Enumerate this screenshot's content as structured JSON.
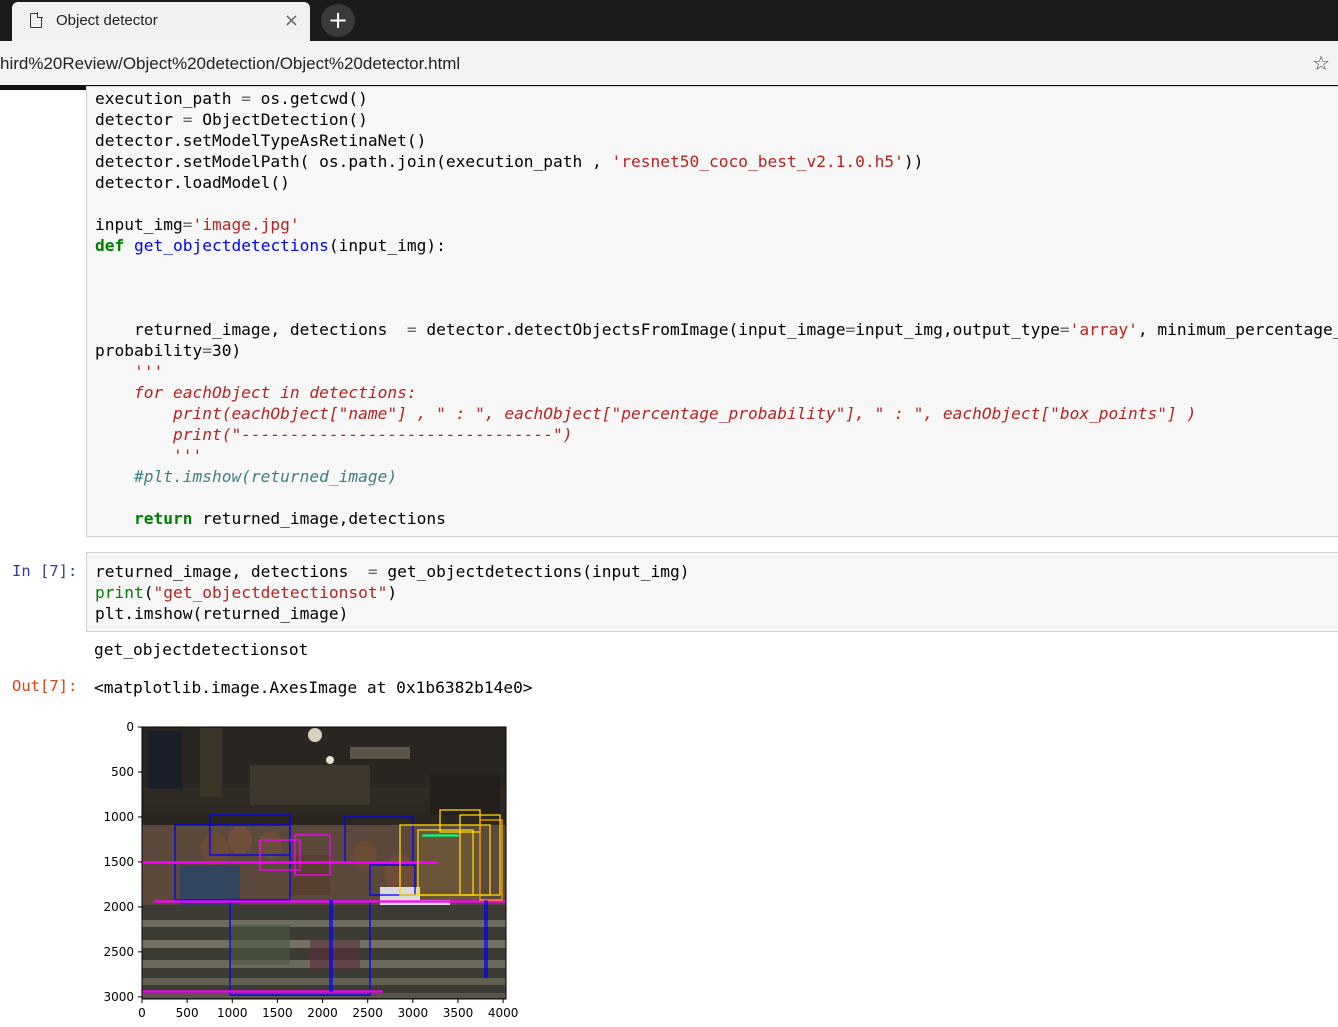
{
  "browser": {
    "tab_title": "Object detector",
    "tab_close": "×",
    "new_tab": "+",
    "address": "hird%20Review/Object%20detection/Object%20detector.html",
    "bookmark_icon": "☆"
  },
  "cell_top": {
    "lines": [
      "execution_path = os.getcwd()",
      "detector = ObjectDetection()",
      "detector.setModelTypeAsRetinaNet()",
      "detector.setModelPath( os.path.join(execution_path , 'resnet50_coco_best_v2.1.0.h5'))",
      "detector.loadModel()",
      "",
      "input_img='image.jpg'",
      "def get_objectdetections(input_img):",
      "",
      "",
      "",
      "    returned_image, detections  = detector.detectObjectsFromImage(input_image=input_img,output_type='array', minimum_percentage_",
      "probability=30)",
      "    '''",
      "    for eachObject in detections:",
      "        print(eachObject[\"name\"] , \" : \", eachObject[\"percentage_probability\"], \" : \", eachObject[\"box_points\"] )",
      "        print(\"--------------------------------\")",
      "        '''",
      "    #plt.imshow(returned_image)",
      "",
      "    return returned_image,detections"
    ]
  },
  "cell_7": {
    "in_prompt": "In [7]:",
    "lines": [
      "returned_image, detections  = get_objectdetections(input_img)",
      "print(\"get_objectdetectionsot\")",
      "plt.imshow(returned_image)"
    ],
    "stdout": "get_objectdetectionsot",
    "out_prompt": "Out[7]:",
    "out_repr": "<matplotlib.image.AxesImage at 0x1b6382b14e0>"
  },
  "chart_data": {
    "type": "image",
    "x_ticks": [
      "0",
      "500",
      "1000",
      "1500",
      "2000",
      "2500",
      "3000",
      "3500",
      "4000"
    ],
    "y_ticks": [
      "0",
      "500",
      "1000",
      "1500",
      "2000",
      "2500",
      "3000"
    ],
    "xlim": [
      0,
      4032
    ],
    "ylim": [
      3024,
      0
    ],
    "box_colors": [
      "#0000ff",
      "#ff00ff",
      "#ffd700",
      "#00ff7f",
      "#ffffff"
    ]
  }
}
